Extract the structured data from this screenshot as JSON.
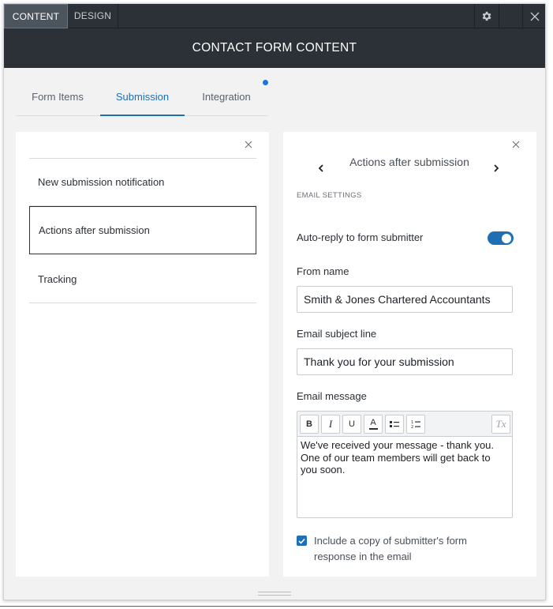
{
  "topbar": {
    "tab_content": "CONTENT",
    "tab_design": "DESIGN",
    "settings_icon": "gear-icon",
    "close_icon": "close-icon"
  },
  "title": "CONTACT FORM CONTENT",
  "subtabs": {
    "form_items": "Form Items",
    "submission": "Submission",
    "integration": "Integration"
  },
  "left_panel": {
    "items": [
      {
        "label": "New submission notification"
      },
      {
        "label": "Actions after submission"
      },
      {
        "label": "Tracking"
      }
    ]
  },
  "right_panel": {
    "title": "Actions after submission",
    "section_label": "EMAIL SETTINGS",
    "autoreply_label": "Auto-reply to form submitter",
    "autoreply_enabled": true,
    "from_name_label": "From name",
    "from_name_value": "Smith & Jones Chartered Accountants",
    "subject_label": "Email subject line",
    "subject_value": "Thank you for your submission",
    "message_label": "Email message",
    "message_value": "We've received your message - thank you. One of our team members will get back to you soon.",
    "toolbar": {
      "bold": "B",
      "italic": "I",
      "underline": "U",
      "text_color": "A",
      "clear_format": "Tx"
    },
    "copy_label": "Include a copy of submitter's form response in the email",
    "copy_checked": true
  },
  "colors": {
    "header_bg": "#2b3136",
    "accent": "#1f6fb2",
    "panel_bg": "#f2f2f2"
  }
}
